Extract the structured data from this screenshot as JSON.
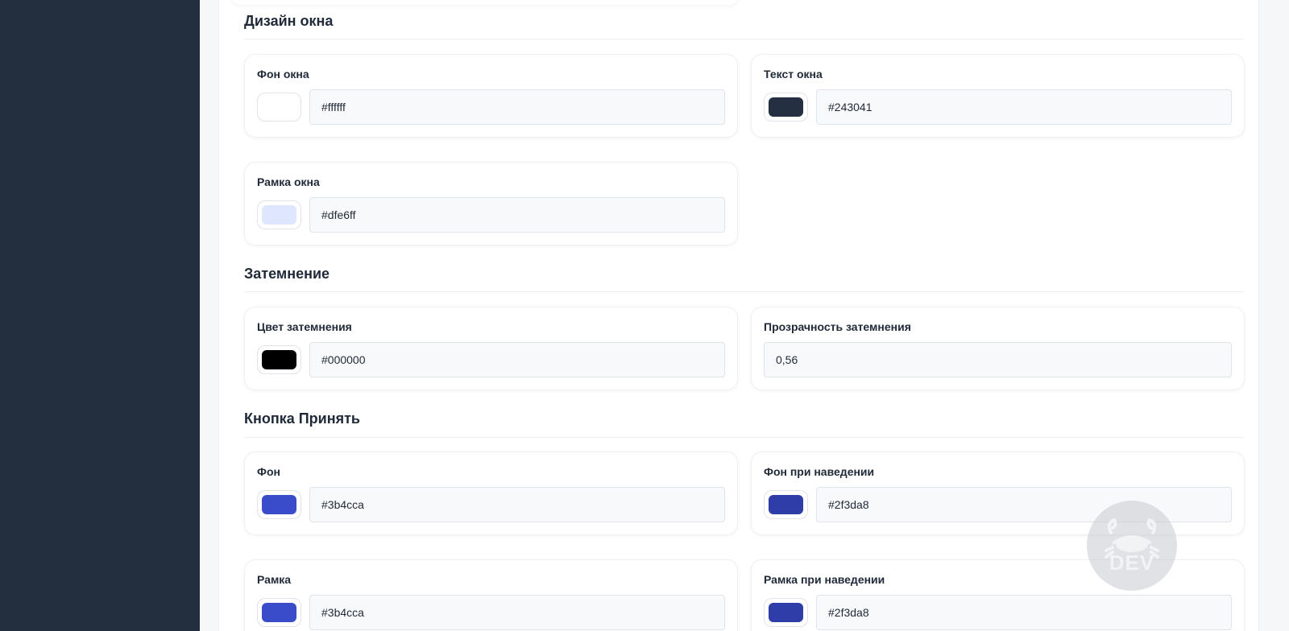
{
  "sections": {
    "window_design": {
      "title": "Дизайн окна"
    },
    "overlay": {
      "title": "Затемнение"
    },
    "accept_button": {
      "title": "Кнопка Принять"
    }
  },
  "fields": {
    "window_bg": {
      "label": "Фон окна",
      "value": "#ffffff",
      "color": "#ffffff"
    },
    "window_text": {
      "label": "Текст окна",
      "value": "#243041",
      "color": "#243041"
    },
    "window_border": {
      "label": "Рамка окна",
      "value": "#dfe6ff",
      "color": "#dfe6ff"
    },
    "overlay_color": {
      "label": "Цвет затемнения",
      "value": "#000000",
      "color": "#000000"
    },
    "overlay_opacity": {
      "label": "Прозрачность затемнения",
      "value": "0,56"
    },
    "btn_bg": {
      "label": "Фон",
      "value": "#3b4cca",
      "color": "#3b4cca"
    },
    "btn_bg_hover": {
      "label": "Фон при наведении",
      "value": "#2f3da8",
      "color": "#2f3da8"
    },
    "btn_border": {
      "label": "Рамка",
      "value": "#3b4cca",
      "color": "#3b4cca"
    },
    "btn_border_hover": {
      "label": "Рамка при наведении",
      "value": "#2f3da8",
      "color": "#2f3da8"
    }
  },
  "watermark": {
    "text": "DEV",
    "icon": "crab-icon"
  },
  "colors": {
    "sidebar": "#232f3e",
    "page_bg": "#f6f7f9",
    "panel_bg": "#ffffff"
  }
}
